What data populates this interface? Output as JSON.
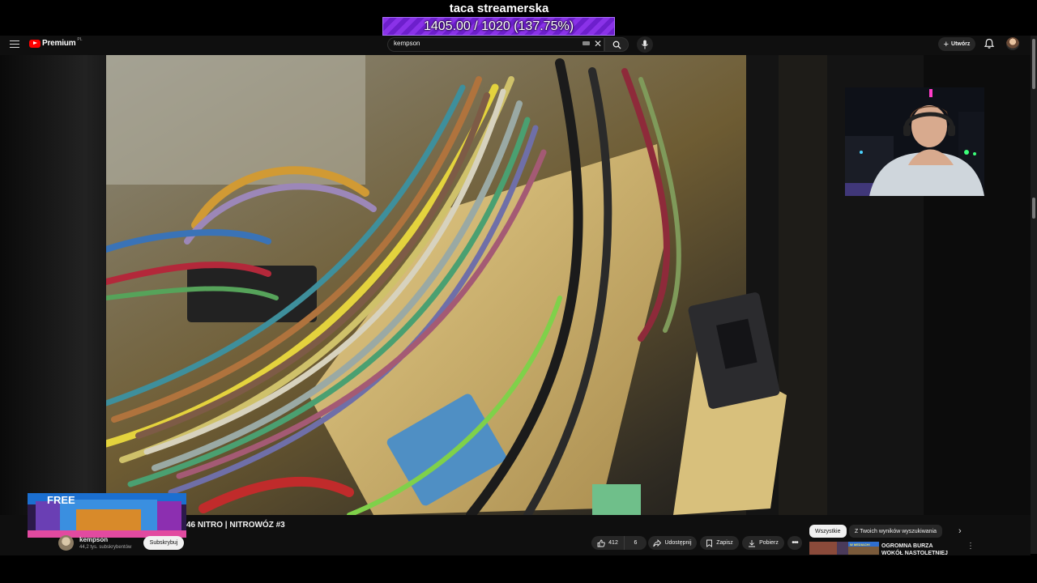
{
  "overlay": {
    "title": "taca streamerska",
    "progress_text": "1405.00 / 1020 (137.75%)",
    "progress_percent": 137.75,
    "colors": {
      "fill": "#8a32e8",
      "border": "#aa70ff"
    }
  },
  "header": {
    "menu_icon": "hamburger-icon",
    "logo_text": "Premium",
    "logo_sup": "PL",
    "search": {
      "value": "kempson",
      "placeholder": ""
    },
    "create_label": "Utwórz",
    "icons": [
      "search-icon",
      "mic-icon",
      "bell-icon",
      "close-icon",
      "keyboard-icon"
    ]
  },
  "video": {
    "title": "46 NITRO | NITROWÓZ #3",
    "channel_name": "kempson",
    "channel_subs": "44,2 tys. subskrybentów",
    "subscribe_label": "Subskrybuj",
    "likes": "412",
    "dislikes": "6",
    "share_label": "Udostępnij",
    "save_label": "Zapisz",
    "download_label": "Pobierz",
    "more_label": "•••"
  },
  "promo": {
    "text": "FREE"
  },
  "sidebar": {
    "chips": [
      "Wszystkie",
      "Z Twoich wyników wyszukiwania"
    ],
    "recommendation": {
      "title": "OGROMNA BURZA WOKÓŁ NASTOLETNIEJ",
      "thumb_label": "W MEDIACH!"
    }
  }
}
